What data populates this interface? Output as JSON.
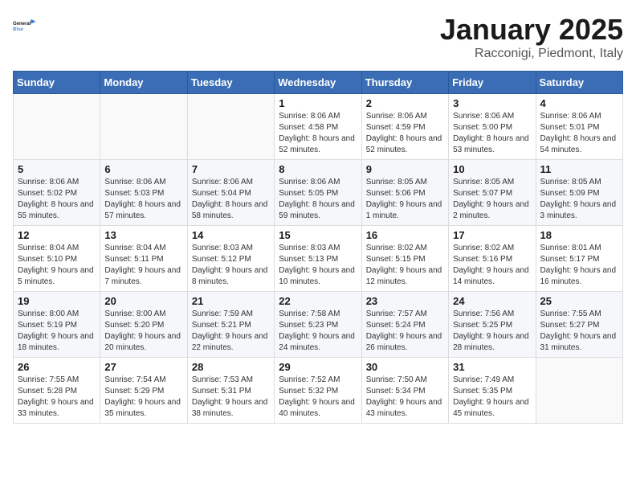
{
  "logo": {
    "line1": "General",
    "line2": "Blue"
  },
  "calendar": {
    "title": "January 2025",
    "subtitle": "Racconigi, Piedmont, Italy"
  },
  "headers": [
    "Sunday",
    "Monday",
    "Tuesday",
    "Wednesday",
    "Thursday",
    "Friday",
    "Saturday"
  ],
  "weeks": [
    [
      {
        "day": "",
        "info": ""
      },
      {
        "day": "",
        "info": ""
      },
      {
        "day": "",
        "info": ""
      },
      {
        "day": "1",
        "info": "Sunrise: 8:06 AM\nSunset: 4:58 PM\nDaylight: 8 hours and 52 minutes."
      },
      {
        "day": "2",
        "info": "Sunrise: 8:06 AM\nSunset: 4:59 PM\nDaylight: 8 hours and 52 minutes."
      },
      {
        "day": "3",
        "info": "Sunrise: 8:06 AM\nSunset: 5:00 PM\nDaylight: 8 hours and 53 minutes."
      },
      {
        "day": "4",
        "info": "Sunrise: 8:06 AM\nSunset: 5:01 PM\nDaylight: 8 hours and 54 minutes."
      }
    ],
    [
      {
        "day": "5",
        "info": "Sunrise: 8:06 AM\nSunset: 5:02 PM\nDaylight: 8 hours and 55 minutes."
      },
      {
        "day": "6",
        "info": "Sunrise: 8:06 AM\nSunset: 5:03 PM\nDaylight: 8 hours and 57 minutes."
      },
      {
        "day": "7",
        "info": "Sunrise: 8:06 AM\nSunset: 5:04 PM\nDaylight: 8 hours and 58 minutes."
      },
      {
        "day": "8",
        "info": "Sunrise: 8:06 AM\nSunset: 5:05 PM\nDaylight: 8 hours and 59 minutes."
      },
      {
        "day": "9",
        "info": "Sunrise: 8:05 AM\nSunset: 5:06 PM\nDaylight: 9 hours and 1 minute."
      },
      {
        "day": "10",
        "info": "Sunrise: 8:05 AM\nSunset: 5:07 PM\nDaylight: 9 hours and 2 minutes."
      },
      {
        "day": "11",
        "info": "Sunrise: 8:05 AM\nSunset: 5:09 PM\nDaylight: 9 hours and 3 minutes."
      }
    ],
    [
      {
        "day": "12",
        "info": "Sunrise: 8:04 AM\nSunset: 5:10 PM\nDaylight: 9 hours and 5 minutes."
      },
      {
        "day": "13",
        "info": "Sunrise: 8:04 AM\nSunset: 5:11 PM\nDaylight: 9 hours and 7 minutes."
      },
      {
        "day": "14",
        "info": "Sunrise: 8:03 AM\nSunset: 5:12 PM\nDaylight: 9 hours and 8 minutes."
      },
      {
        "day": "15",
        "info": "Sunrise: 8:03 AM\nSunset: 5:13 PM\nDaylight: 9 hours and 10 minutes."
      },
      {
        "day": "16",
        "info": "Sunrise: 8:02 AM\nSunset: 5:15 PM\nDaylight: 9 hours and 12 minutes."
      },
      {
        "day": "17",
        "info": "Sunrise: 8:02 AM\nSunset: 5:16 PM\nDaylight: 9 hours and 14 minutes."
      },
      {
        "day": "18",
        "info": "Sunrise: 8:01 AM\nSunset: 5:17 PM\nDaylight: 9 hours and 16 minutes."
      }
    ],
    [
      {
        "day": "19",
        "info": "Sunrise: 8:00 AM\nSunset: 5:19 PM\nDaylight: 9 hours and 18 minutes."
      },
      {
        "day": "20",
        "info": "Sunrise: 8:00 AM\nSunset: 5:20 PM\nDaylight: 9 hours and 20 minutes."
      },
      {
        "day": "21",
        "info": "Sunrise: 7:59 AM\nSunset: 5:21 PM\nDaylight: 9 hours and 22 minutes."
      },
      {
        "day": "22",
        "info": "Sunrise: 7:58 AM\nSunset: 5:23 PM\nDaylight: 9 hours and 24 minutes."
      },
      {
        "day": "23",
        "info": "Sunrise: 7:57 AM\nSunset: 5:24 PM\nDaylight: 9 hours and 26 minutes."
      },
      {
        "day": "24",
        "info": "Sunrise: 7:56 AM\nSunset: 5:25 PM\nDaylight: 9 hours and 28 minutes."
      },
      {
        "day": "25",
        "info": "Sunrise: 7:55 AM\nSunset: 5:27 PM\nDaylight: 9 hours and 31 minutes."
      }
    ],
    [
      {
        "day": "26",
        "info": "Sunrise: 7:55 AM\nSunset: 5:28 PM\nDaylight: 9 hours and 33 minutes."
      },
      {
        "day": "27",
        "info": "Sunrise: 7:54 AM\nSunset: 5:29 PM\nDaylight: 9 hours and 35 minutes."
      },
      {
        "day": "28",
        "info": "Sunrise: 7:53 AM\nSunset: 5:31 PM\nDaylight: 9 hours and 38 minutes."
      },
      {
        "day": "29",
        "info": "Sunrise: 7:52 AM\nSunset: 5:32 PM\nDaylight: 9 hours and 40 minutes."
      },
      {
        "day": "30",
        "info": "Sunrise: 7:50 AM\nSunset: 5:34 PM\nDaylight: 9 hours and 43 minutes."
      },
      {
        "day": "31",
        "info": "Sunrise: 7:49 AM\nSunset: 5:35 PM\nDaylight: 9 hours and 45 minutes."
      },
      {
        "day": "",
        "info": ""
      }
    ]
  ]
}
